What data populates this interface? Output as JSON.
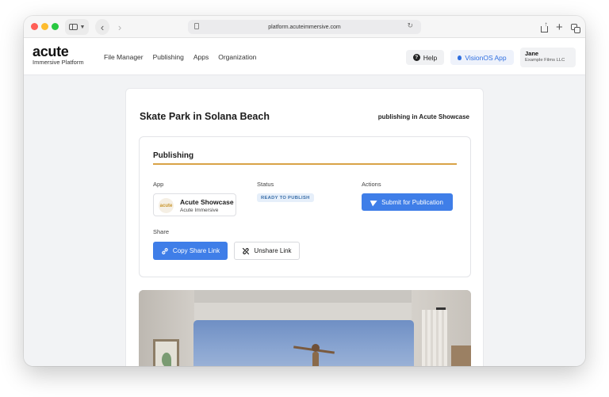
{
  "browser": {
    "url": "platform.acuteimmersive.com"
  },
  "brand": {
    "name": "acute",
    "subtitle": "Immersive Platform"
  },
  "nav": {
    "items": [
      "File Manager",
      "Publishing",
      "Apps",
      "Organization"
    ],
    "help_label": "Help",
    "vision_label": "VisionOS App",
    "user_name": "Jane",
    "user_org": "Example Films LLC"
  },
  "page": {
    "title": "Skate Park in Solana Beach",
    "publishing_in": "publishing in Acute Showcase"
  },
  "publishing_card": {
    "title": "Publishing",
    "app_label": "App",
    "status_label": "Status",
    "actions_label": "Actions",
    "app_logo_text": "acute",
    "app_name": "Acute Showcase",
    "app_org": "Acute Immersive",
    "status_value": "READY TO PUBLISH",
    "submit_label": "Submit for Publication",
    "share_label": "Share",
    "copy_label": "Copy Share Link",
    "unshare_label": "Unshare Link"
  },
  "colors": {
    "accent_blue": "#3f7ee8",
    "divider_gold": "#d9a347",
    "status_badge_bg": "#e6effa"
  }
}
